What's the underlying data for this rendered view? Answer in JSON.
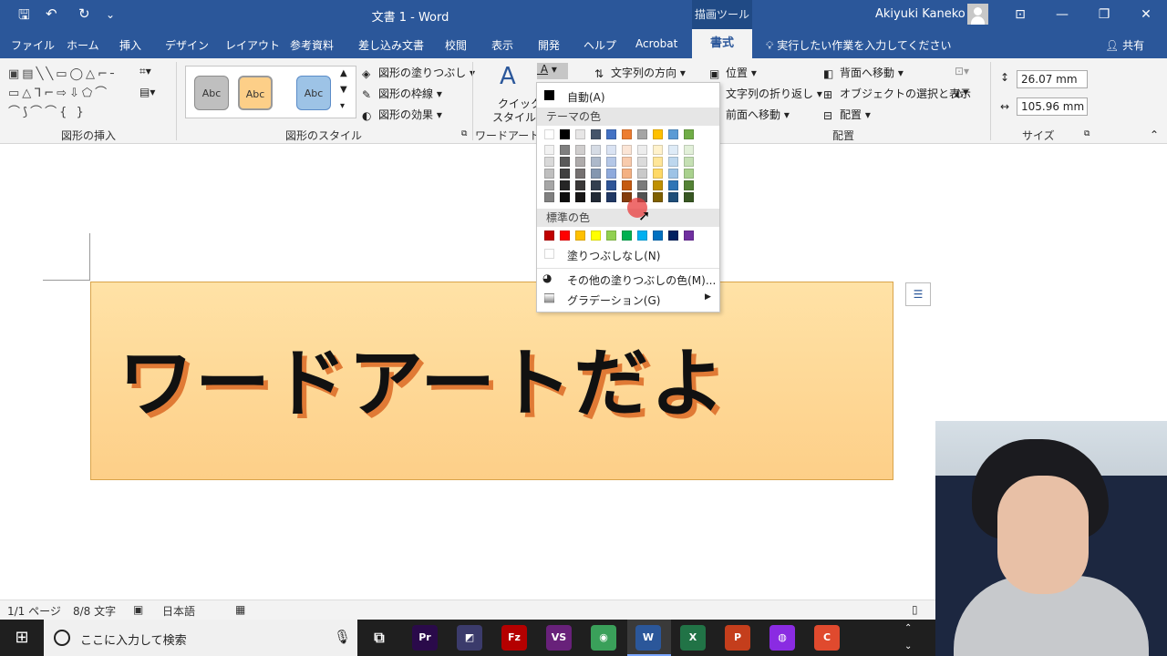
{
  "titlebar": {
    "doc_title": "文書 1  -  Word",
    "context_tab_group": "描画ツール",
    "user": "Akiyuki Kaneko",
    "qat": {
      "save": "🖫",
      "undo": "↶",
      "redo": "↻",
      "customize": "⌄"
    },
    "window_buttons": {
      "ribbon_display": "⊡",
      "minimize": "—",
      "restore": "❐",
      "close": "✕"
    }
  },
  "tabs": [
    "ファイル",
    "ホーム",
    "挿入",
    "デザイン",
    "レイアウト",
    "参考資料",
    "差し込み文書",
    "校閲",
    "表示",
    "開発",
    "ヘルプ",
    "Acrobat"
  ],
  "active_tab": "書式",
  "tellme": "実行したい作業を入力してください",
  "share": "共有",
  "ribbon": {
    "groups": {
      "insert_shapes": "図形の挿入",
      "shape_styles": "図形のスタイル",
      "wordart_styles": "ワードアートの",
      "arrange": "配置",
      "size": "サイズ"
    },
    "shape_glyphs": "▣▤╲╲▭◯△⌐╴\n▭△ᒣ⌐⇨⇩⬠⌒\n⌒⟆⌒⌒{ }",
    "style_samples": [
      "Abc",
      "Abc",
      "Abc"
    ],
    "shape_fill": "図形の塗りつぶし",
    "shape_outline": "図形の枠線",
    "shape_effects": "図形の効果",
    "quick_styles_1": "クイック",
    "quick_styles_2": "スタイル",
    "text_direction": "文字列の方向",
    "position": "位置",
    "wrap_text": "文字列の折り返し",
    "bring_forward": "前面へ移動",
    "send_backward": "背面へ移動",
    "selection_pane": "オブジェクトの選択と表示",
    "align": "配置",
    "height": "26.07 mm",
    "width": "105.96 mm"
  },
  "color_menu": {
    "automatic": "自動(A)",
    "theme_colors": "テーマの色",
    "standard_colors": "標準の色",
    "no_fill": "塗りつぶしなし(N)",
    "more_colors": "その他の塗りつぶしの色(M)...",
    "gradient": "グラデーション(G)",
    "theme_palette": [
      [
        "#ffffff",
        "#f2f2f2",
        "#d9d9d9",
        "#bfbfbf",
        "#a6a6a6",
        "#808080"
      ],
      [
        "#000000",
        "#7f7f7f",
        "#595959",
        "#404040",
        "#262626",
        "#0d0d0d"
      ],
      [
        "#e7e6e6",
        "#d0cece",
        "#aeabab",
        "#757171",
        "#3a3838",
        "#171616"
      ],
      [
        "#44546a",
        "#d6dce5",
        "#adb9ca",
        "#8497b0",
        "#333f50",
        "#222a35"
      ],
      [
        "#4472c4",
        "#dae3f3",
        "#b4c7e7",
        "#8faadc",
        "#2f5597",
        "#203864"
      ],
      [
        "#ed7d31",
        "#fbe5d6",
        "#f8cbad",
        "#f4b183",
        "#c55a11",
        "#843c0c"
      ],
      [
        "#a5a5a5",
        "#ededed",
        "#dbdbdb",
        "#c9c9c9",
        "#7b7b7b",
        "#525252"
      ],
      [
        "#ffc000",
        "#fff2cc",
        "#ffe699",
        "#ffd966",
        "#bf9000",
        "#7f6000"
      ],
      [
        "#5b9bd5",
        "#deebf7",
        "#bdd7ee",
        "#9dc3e6",
        "#2e75b6",
        "#1f4e79"
      ],
      [
        "#70ad47",
        "#e2f0d9",
        "#c5e0b4",
        "#a9d18e",
        "#548235",
        "#385723"
      ]
    ],
    "standard_palette": [
      "#c00000",
      "#ff0000",
      "#ffc000",
      "#ffff00",
      "#92d050",
      "#00b050",
      "#00b0f0",
      "#0070c0",
      "#002060",
      "#7030a0"
    ]
  },
  "document": {
    "wordart_text": "ワードアートだよ",
    "wordart_fill": "#fdcf88",
    "wordart_shadow": "#e07a35"
  },
  "status": {
    "page": "1/1 ページ",
    "words": "8/8 文字",
    "language": "日本語"
  },
  "taskbar": {
    "search_placeholder": "ここに入力して検索",
    "apps": [
      {
        "name": "premiere",
        "label": "Pr",
        "color": "#2a0a4a"
      },
      {
        "name": "vector",
        "label": "◩",
        "color": "#3b3b6b"
      },
      {
        "name": "filezilla",
        "label": "Fz",
        "color": "#b40000"
      },
      {
        "name": "visual-studio",
        "label": "VS",
        "color": "#68217a"
      },
      {
        "name": "chrome-like",
        "label": "◉",
        "color": "#3aa05a"
      },
      {
        "name": "word",
        "label": "W",
        "color": "#2b579a"
      },
      {
        "name": "excel",
        "label": "X",
        "color": "#217346"
      },
      {
        "name": "powerpoint",
        "label": "P",
        "color": "#c43e1c"
      },
      {
        "name": "recorder",
        "label": "◍",
        "color": "#8a2be2"
      },
      {
        "name": "app-red",
        "label": "C",
        "color": "#e04a2e"
      }
    ]
  }
}
